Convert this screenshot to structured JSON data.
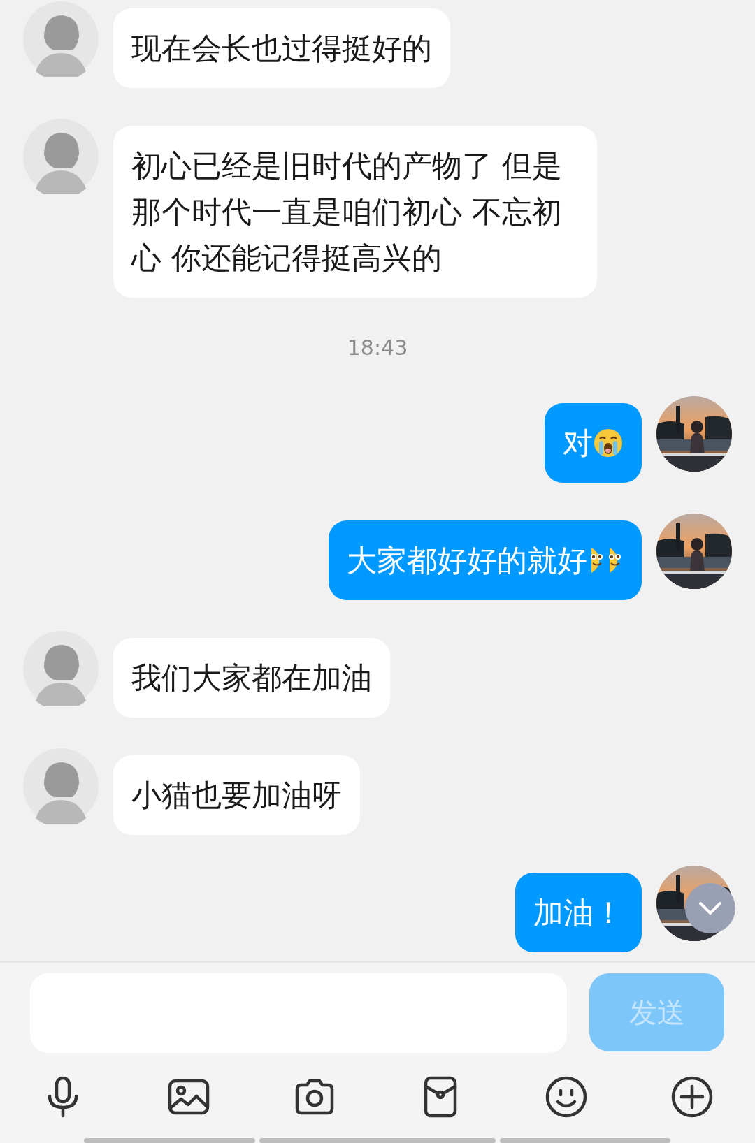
{
  "messages": [
    {
      "kind": "received",
      "text": "现在会长也过得挺好的"
    },
    {
      "kind": "received",
      "text": "初心已经是旧时代的产物了 但是那个时代一直是咱们初心 不忘初心 你还能记得挺高兴的"
    },
    {
      "kind": "time",
      "text": "18:43"
    },
    {
      "kind": "sent",
      "text": "对",
      "emojis": [
        {
          "kind": "crying"
        }
      ]
    },
    {
      "kind": "sent",
      "text": "大家都好好的就好",
      "emojis": [
        {
          "kind": "smiling"
        },
        {
          "kind": "smiling"
        }
      ]
    },
    {
      "kind": "received",
      "text": "我们大家都在加油"
    },
    {
      "kind": "received",
      "text": "小猫也要加油呀"
    },
    {
      "kind": "sent",
      "text": "加油！"
    }
  ],
  "composer": {
    "send_button": {
      "label": "发送",
      "disabled": true
    }
  }
}
